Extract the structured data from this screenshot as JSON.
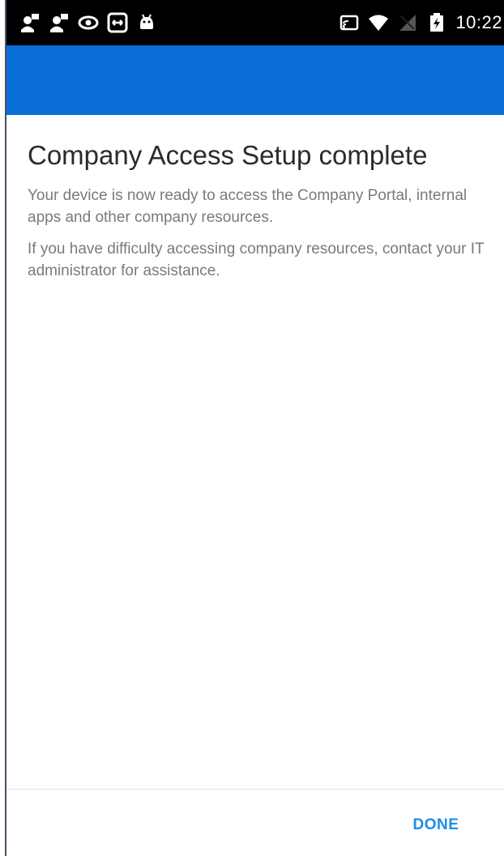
{
  "status_bar": {
    "time": "10:22",
    "left_icons": [
      "notification-user-icon",
      "notification-user-icon-2",
      "eye-icon",
      "remote-control-icon",
      "android-icon"
    ],
    "right_icons": [
      "cast-icon",
      "wifi-icon",
      "no-signal-icon",
      "battery-charging-icon"
    ]
  },
  "app_bar": {
    "color": "#0a6ed8"
  },
  "main": {
    "title": "Company Access Setup complete",
    "paragraph1": "Your device is now ready to access the Company Portal, internal apps and other company resources.",
    "paragraph2": "If you have difficulty accessing company resources, contact your IT administrator for assistance."
  },
  "footer": {
    "done_label": "DONE",
    "accent_color": "#1a8fe8"
  }
}
